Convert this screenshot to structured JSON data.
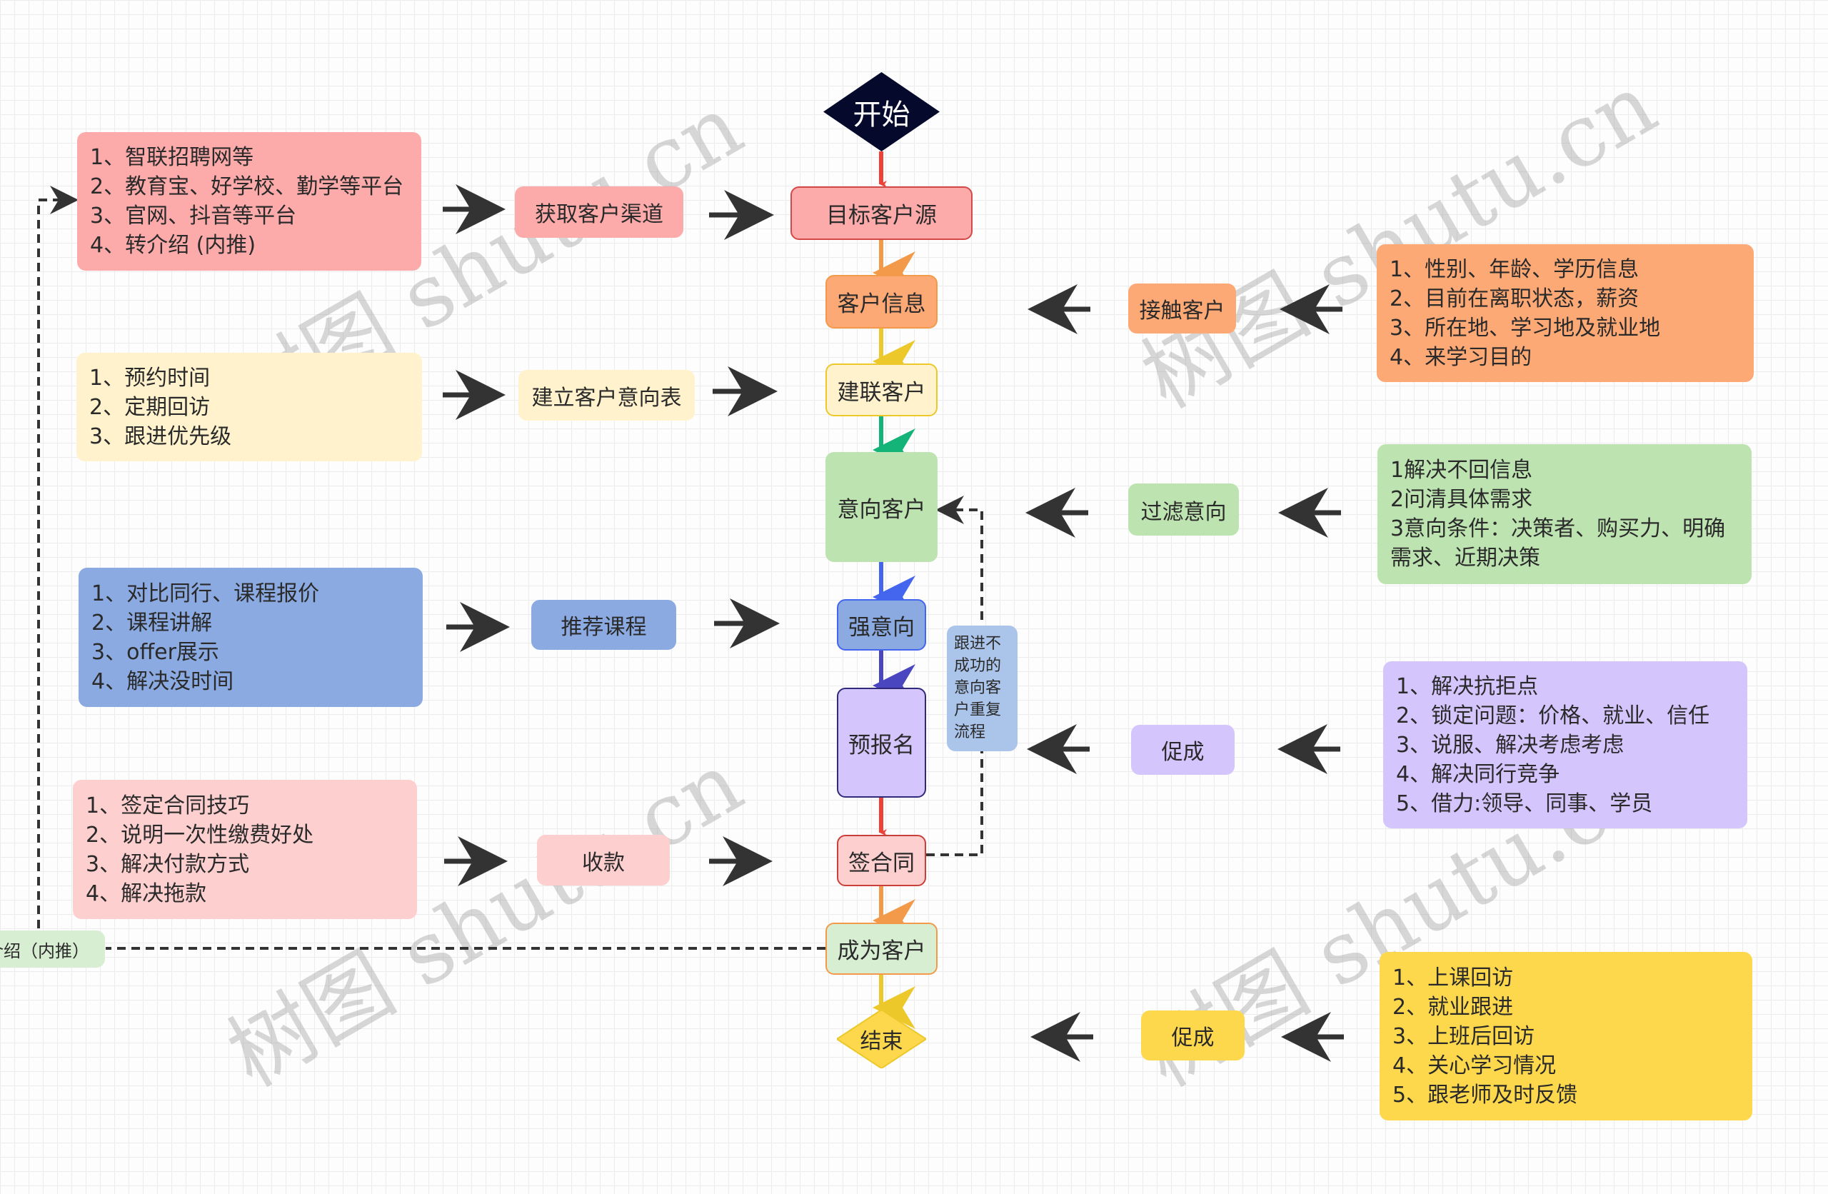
{
  "flow": {
    "start": "开始",
    "target_source": "目标客户源",
    "customer_info": "客户信息",
    "build_contact": "建联客户",
    "intent_customer": "意向客户",
    "strong_intent": "强意向",
    "pre_register": "预报名",
    "sign_contract": "签合同",
    "become_customer": "成为客户",
    "end": "结束"
  },
  "left": {
    "channels": {
      "label": "获取客户渠道",
      "items": [
        "1、智联招聘网等",
        "2、教育宝、好学校、勤学等平台",
        "3、官网、抖音等平台",
        "4、转介绍 (内推)"
      ]
    },
    "intent_table": {
      "label": "建立客户意向表",
      "items": [
        "1、预约时间",
        "2、定期回访",
        "3、跟进优先级"
      ]
    },
    "recommend": {
      "label": "推荐课程",
      "items": [
        "1、对比同行、课程报价",
        "2、课程讲解",
        "3、offer展示",
        "4、解决没时间"
      ]
    },
    "payment": {
      "label": "收款",
      "items": [
        "1、签定合同技巧",
        "2、说明一次性缴费好处",
        "3、解决付款方式",
        "4、解决拖款"
      ]
    },
    "referral_tag": "介绍（内推）"
  },
  "right": {
    "contact": {
      "label": "接触客户",
      "items": [
        "1、性别、年龄、学历信息",
        "2、目前在离职状态，薪资",
        "3、所在地、学习地及就业地",
        "4、来学习目的"
      ]
    },
    "filter": {
      "label": "过滤意向",
      "items": [
        "1解决不回信息",
        "2问清具体需求",
        "3意向条件：决策者、购买力、明确",
        "需求、近期决策"
      ]
    },
    "promote": {
      "label": "促成",
      "items": [
        "1、解决抗拒点",
        "2、锁定问题：价格、就业、信任",
        "3、说服、解决考虑考虑",
        "4、解决同行竞争",
        "5、借力:领导、同事、学员"
      ]
    },
    "promote_after": {
      "label": "促成",
      "items": [
        "1、上课回访",
        "2、就业跟进",
        "3、上班后回访",
        "4、关心学习情况",
        "5、跟老师及时反馈"
      ]
    }
  },
  "loop_note": "跟进不成功的意向客户重复流程",
  "watermark": "树图 shutu.cn",
  "colors": {
    "pink": "#fdaaaa",
    "light_pink": "#fecfcf",
    "orange": "#fda976",
    "cream": "#fff2cc",
    "green": "#bde3b1",
    "blue": "#8aaae1",
    "light_blue": "#abc4ea",
    "lavender": "#d5c5fd",
    "yellow": "#fed84c",
    "mint": "#d8eed2",
    "navy": "#050a2c"
  }
}
